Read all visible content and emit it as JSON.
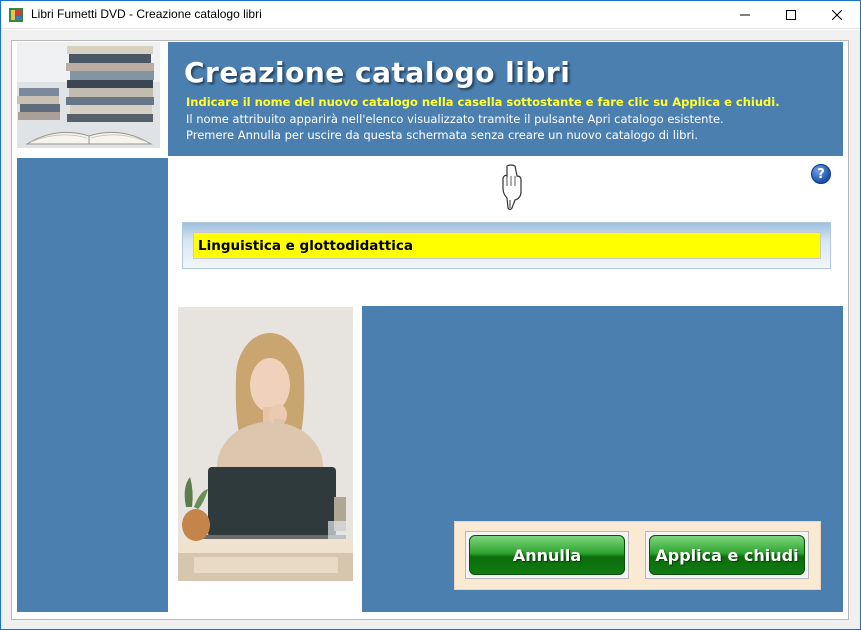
{
  "window": {
    "title": "Libri Fumetti DVD - Creazione catalogo libri"
  },
  "header": {
    "title": "Creazione catalogo libri",
    "line1": "Indicare il nome del nuovo catalogo nella casella sottostante e fare clic su Applica e chiudi.",
    "line2": "Il nome attribuito apparirà nell'elenco visualizzato tramite il pulsante Apri catalogo esistente.",
    "line3": "Premere Annulla per uscire da questa schermata senza creare un nuovo catalogo di libri."
  },
  "form": {
    "catalog_name_value": "Linguistica e glottodidattica"
  },
  "help": {
    "label": "?"
  },
  "buttons": {
    "cancel_label": "Annulla",
    "apply_label": "Applica e chiudi"
  },
  "colors": {
    "panel_blue": "#4a7fb0",
    "header_highlight": "#ffff33",
    "input_background": "#ffff00",
    "button_green": "#2fa32f",
    "buttons_box": "#fbead3"
  },
  "icons": [
    "app-icon",
    "minimize-icon",
    "maximize-icon",
    "close-icon",
    "help-icon",
    "pointing-hand-icon"
  ]
}
